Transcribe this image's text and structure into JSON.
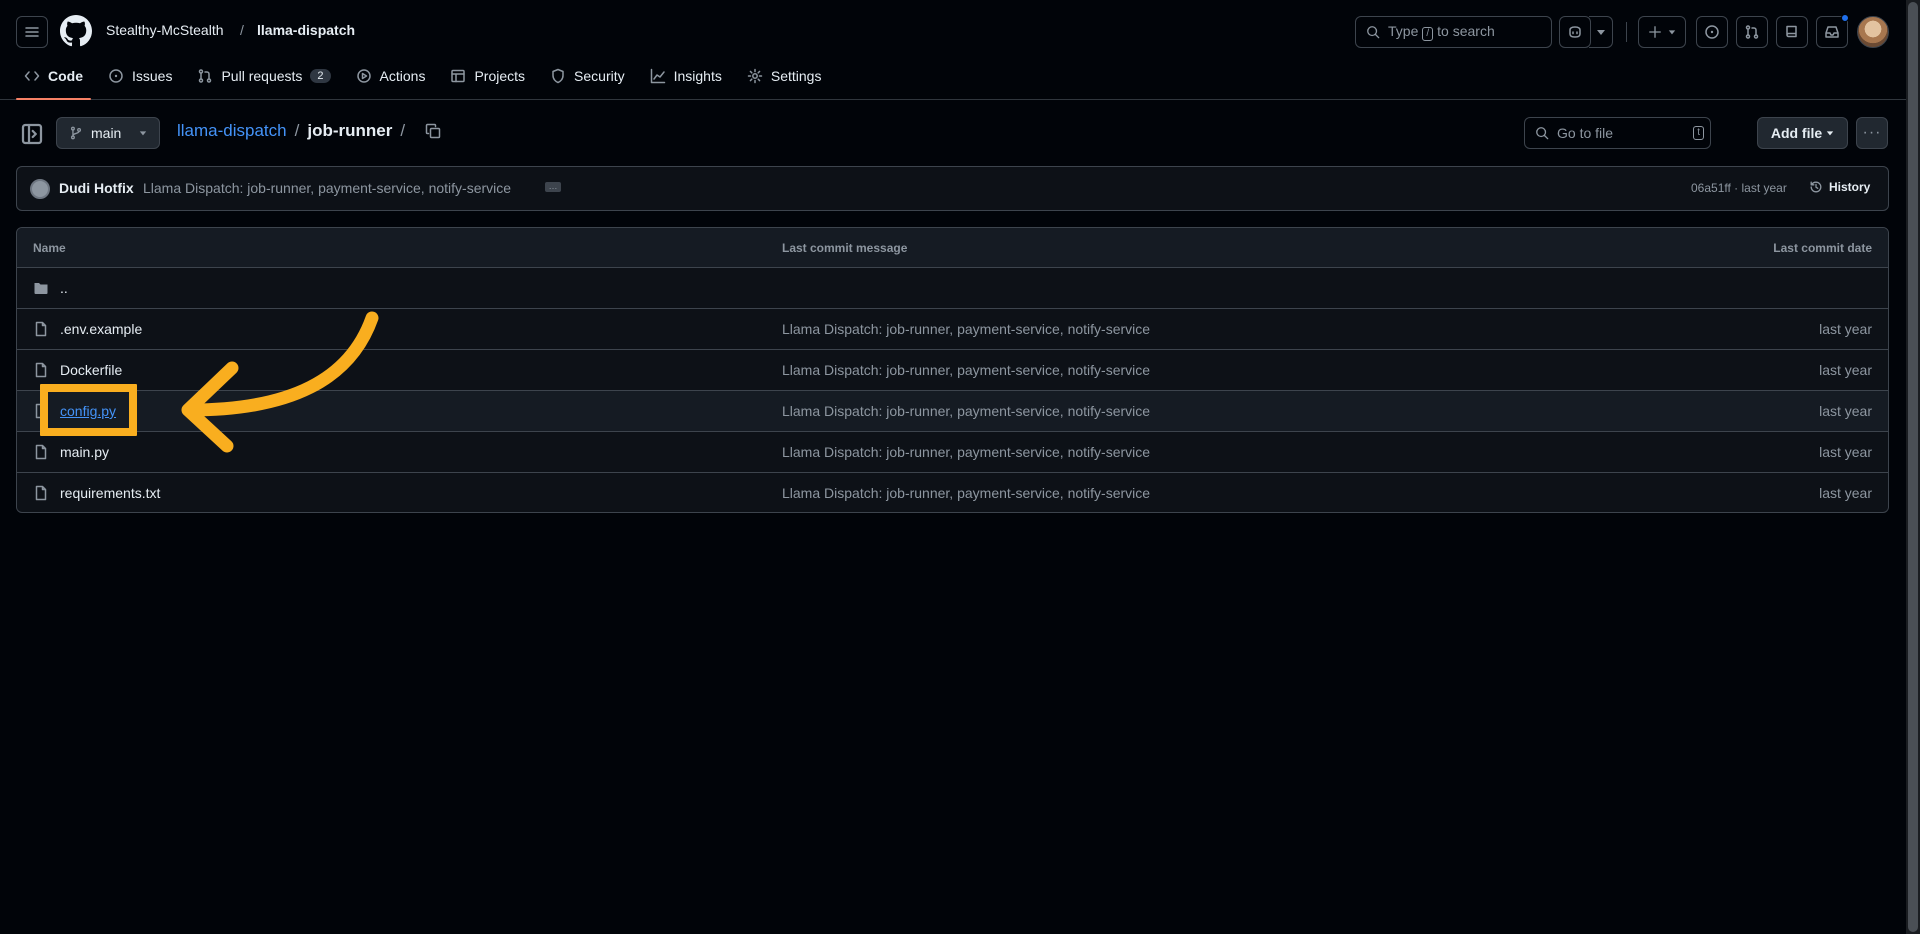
{
  "header": {
    "owner": "Stealthy-McStealth",
    "separator": "/",
    "repo": "llama-dispatch",
    "search_prefix": "Type",
    "search_key": "/",
    "search_suffix": "to search"
  },
  "tabs": [
    {
      "label": "Code",
      "icon": "code-icon"
    },
    {
      "label": "Issues",
      "icon": "issue-icon"
    },
    {
      "label": "Pull requests",
      "icon": "pull-request-icon",
      "count": "2"
    },
    {
      "label": "Actions",
      "icon": "play-icon"
    },
    {
      "label": "Projects",
      "icon": "table-icon"
    },
    {
      "label": "Security",
      "icon": "shield-icon"
    },
    {
      "label": "Insights",
      "icon": "graph-icon"
    },
    {
      "label": "Settings",
      "icon": "gear-icon"
    }
  ],
  "pathbar": {
    "branch": "main",
    "root": "llama-dispatch",
    "sep": "/",
    "folder": "job-runner",
    "trail": "/",
    "goto_placeholder": "Go to file",
    "goto_key": "t",
    "add_file": "Add file",
    "more": "···"
  },
  "commit": {
    "author": "Dudi Hotfix",
    "message": "Llama Dispatch: job-runner, payment-service, notify-service",
    "meta": "06a51ff · last year",
    "history": "History"
  },
  "table": {
    "col_name": "Name",
    "col_msg": "Last commit message",
    "col_date": "Last commit date",
    "rows": [
      {
        "name": "..",
        "type": "folder",
        "message": "",
        "date": ""
      },
      {
        "name": ".env.example",
        "type": "file",
        "message": "Llama Dispatch: job-runner, payment-service, notify-service",
        "date": "last year"
      },
      {
        "name": "Dockerfile",
        "type": "file",
        "message": "Llama Dispatch: job-runner, payment-service, notify-service",
        "date": "last year"
      },
      {
        "name": "config.py",
        "type": "file",
        "message": "Llama Dispatch: job-runner, payment-service, notify-service",
        "date": "last year"
      },
      {
        "name": "main.py",
        "type": "file",
        "message": "Llama Dispatch: job-runner, payment-service, notify-service",
        "date": "last year"
      },
      {
        "name": "requirements.txt",
        "type": "file",
        "message": "Llama Dispatch: job-runner, payment-service, notify-service",
        "date": "last year"
      }
    ]
  },
  "colors": {
    "accent_link": "#4493f8",
    "tab_underline": "#f78166",
    "annotation": "#f9ae1f",
    "background": "#010409"
  }
}
